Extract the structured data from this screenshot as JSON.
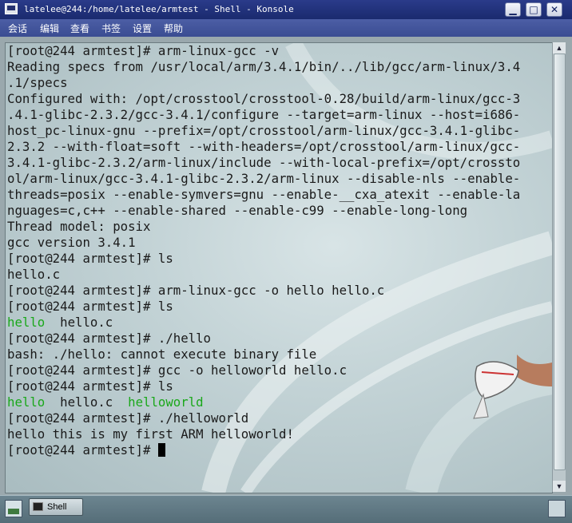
{
  "window": {
    "title": "latelee@244:/home/latelee/armtest - Shell - Konsole",
    "controls": {
      "minimize": "▁",
      "maximize": "□",
      "close": "✕"
    }
  },
  "menu": [
    "会话",
    "编辑",
    "查看",
    "书签",
    "设置",
    "帮助"
  ],
  "terminal": {
    "lines": [
      "[root@244 armtest]# arm-linux-gcc -v",
      "Reading specs from /usr/local/arm/3.4.1/bin/../lib/gcc/arm-linux/3.4",
      ".1/specs",
      "Configured with: /opt/crosstool/crosstool-0.28/build/arm-linux/gcc-3",
      ".4.1-glibc-2.3.2/gcc-3.4.1/configure --target=arm-linux --host=i686-",
      "host_pc-linux-gnu --prefix=/opt/crosstool/arm-linux/gcc-3.4.1-glibc-",
      "2.3.2 --with-float=soft --with-headers=/opt/crosstool/arm-linux/gcc-",
      "3.4.1-glibc-2.3.2/arm-linux/include --with-local-prefix=/opt/crossto",
      "ol/arm-linux/gcc-3.4.1-glibc-2.3.2/arm-linux --disable-nls --enable-",
      "threads=posix --enable-symvers=gnu --enable-__cxa_atexit --enable-la",
      "nguages=c,c++ --enable-shared --enable-c99 --enable-long-long",
      "Thread model: posix",
      "gcc version 3.4.1",
      "[root@244 armtest]# ls",
      "hello.c",
      "[root@244 armtest]# arm-linux-gcc -o hello hello.c",
      "[root@244 armtest]# ls"
    ],
    "ls1": {
      "exe": "hello",
      "src": "hello.c"
    },
    "lines2": [
      "[root@244 armtest]# ./hello",
      "bash: ./hello: cannot execute binary file",
      "[root@244 armtest]# gcc -o helloworld hello.c",
      "[root@244 armtest]# ls"
    ],
    "ls2": {
      "exe1": "hello",
      "src": "hello.c",
      "exe2": "helloworld"
    },
    "lines3": [
      "[root@244 armtest]# ./helloworld",
      "hello this is my first ARM helloworld!"
    ],
    "prompt": "[root@244 armtest]# ",
    "exec_color": "#1aa81a"
  },
  "taskbar": {
    "task_label": "Shell"
  }
}
